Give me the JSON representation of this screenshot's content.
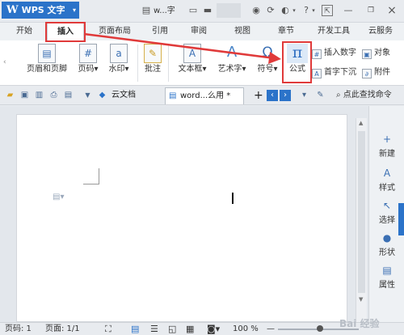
{
  "app": {
    "name": "WPS 文字",
    "doc_title_short": "w...字"
  },
  "title_icons": [
    "document-icon",
    "shirt-icon",
    "minimize-dash-icon"
  ],
  "window_controls": {
    "settings": "settings-icon",
    "help": "?",
    "minimize": "—",
    "restore": "restore-icon",
    "close": "×"
  },
  "tabs": [
    "开始",
    "插入",
    "页面布局",
    "引用",
    "审阅",
    "视图",
    "章节",
    "开发工具",
    "云服务"
  ],
  "active_tab": "插入",
  "ribbon": {
    "header_footer": "页眉和页脚",
    "page_number": "页码",
    "watermark": "水印",
    "comment": "批注",
    "textbox": "文本框",
    "wordart": "艺术字",
    "symbol": "符号",
    "formula": "公式",
    "formula_glyph": "π",
    "insert_number": "插入数字",
    "drop_cap": "首字下沉",
    "object": "对象",
    "attachment": "附件",
    "dropdown_arrow": "▾"
  },
  "doc_tabs": {
    "cloud": "云文档",
    "active_doc": "word...么用 *",
    "add": "+",
    "search": "点此查找命令"
  },
  "side_panel": [
    "新建",
    "样式",
    "选择",
    "形状",
    "属性"
  ],
  "status": {
    "page": "页码: 1",
    "pages": "页面: 1/1",
    "zoom": "100 %",
    "zoom_minus": "—",
    "watermark_text": "Bai 经验"
  },
  "colors": {
    "brand_blue": "#2b73c9",
    "annotation_red": "#e03a3a"
  }
}
